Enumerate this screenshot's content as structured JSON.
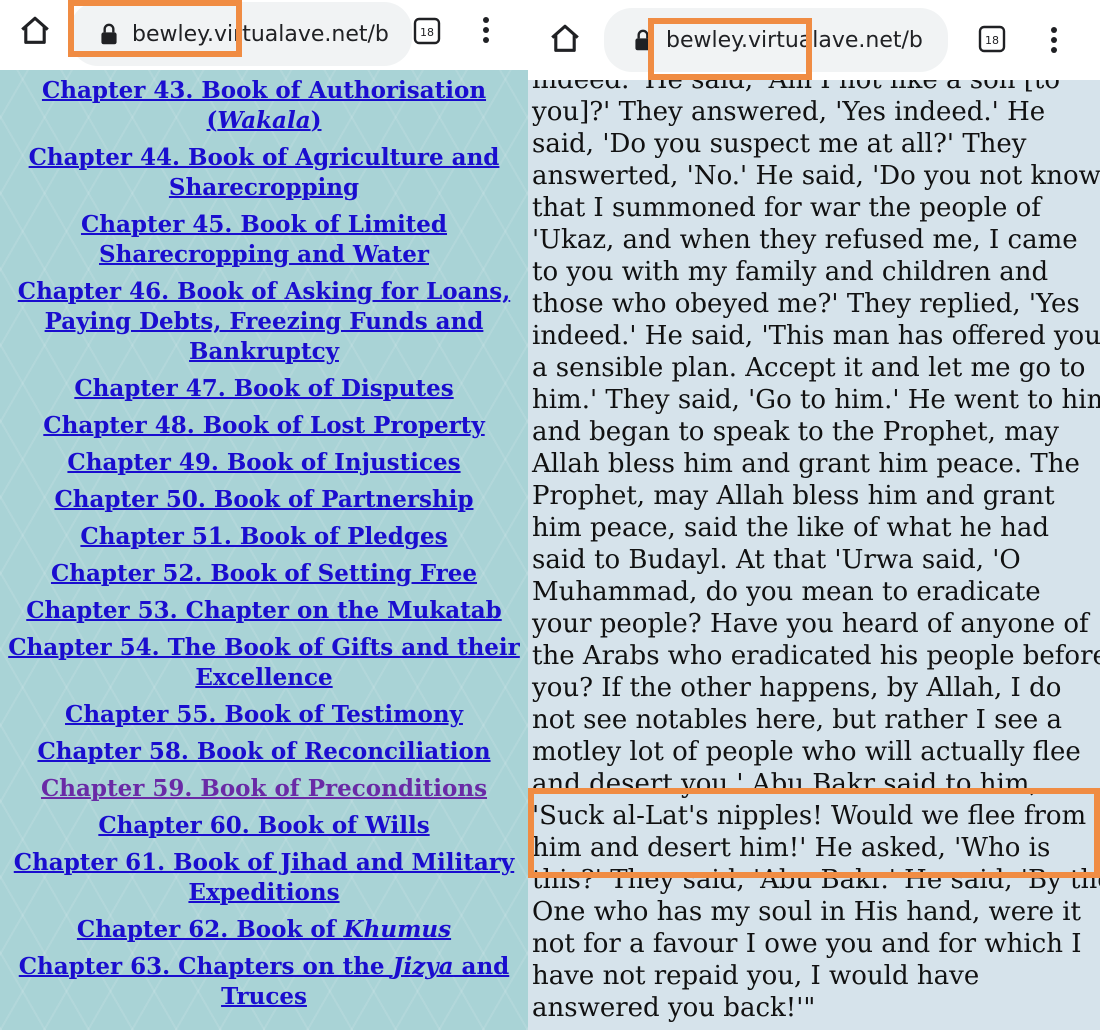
{
  "left_browser": {
    "url": "bewley.virtualave.net/b",
    "tab_count": "18",
    "icons": [
      "home-icon",
      "lock-icon",
      "tab-switcher-icon",
      "overflow-menu-icon"
    ]
  },
  "right_browser": {
    "url": "bewley.virtualave.net/b",
    "tab_count": "18",
    "icons": [
      "home-icon",
      "lock-icon",
      "tab-switcher-icon",
      "overflow-menu-icon"
    ]
  },
  "left_page": {
    "chapters": [
      {
        "pre": "Chapter 43. Book of Authorisation (",
        "em": "Wakala",
        "post": ")"
      },
      {
        "pre": "Chapter 44. Book of Agriculture and Sharecropping"
      },
      {
        "pre": "Chapter 45. Book of Limited Sharecropping and Water"
      },
      {
        "pre": "Chapter 46. Book of Asking for Loans, Paying Debts, Freezing Funds and Bankruptcy"
      },
      {
        "pre": "Chapter 47. Book of Disputes"
      },
      {
        "pre": "Chapter 48. Book of Lost Property"
      },
      {
        "pre": "Chapter 49. Book of Injustices"
      },
      {
        "pre": "Chapter 50. Book of Partnership"
      },
      {
        "pre": "Chapter 51. Book of Pledges"
      },
      {
        "pre": "Chapter 52. Book of Setting Free"
      },
      {
        "pre": "Chapter 53. Chapter on the Mukatab"
      },
      {
        "pre": "Chapter 54. The Book of Gifts and their Excellence"
      },
      {
        "pre": "Chapter 55. Book of Testimony"
      },
      {
        "pre": "Chapter 58. Book of Reconciliation"
      },
      {
        "pre": "Chapter 59. Book of Preconditions",
        "visited": true
      },
      {
        "pre": "Chapter 60. Book of Wills"
      },
      {
        "pre": "Chapter 61. Book of Jihad and Military Expeditions"
      },
      {
        "pre": "Chapter 62. Book of ",
        "em": "Khumus"
      },
      {
        "pre": "Chapter 63. Chapters on the ",
        "em": "Jizya",
        "post": " and Truces"
      }
    ]
  },
  "right_page": {
    "lines": [
      "indeed.' He said, 'Am I not like a son [to",
      "you]?' They answered, 'Yes indeed.' He",
      "said, 'Do you suspect me at all?' They",
      "answerted, 'No.' He said, 'Do you not know",
      "that I summoned for war the people of",
      "'Ukaz, and when they refused me, I came",
      "to you with my family and children and",
      "those who obeyed me?' They replied, 'Yes",
      "indeed.' He said, 'This man has offered you",
      "a sensible plan. Accept it and let me go to",
      "him.' They said, 'Go to him.' He went to him",
      "and began to speak to the Prophet, may",
      "Allah bless him and grant him peace. The",
      "Prophet, may Allah bless him and grant",
      "him peace, said the like of what he had",
      "said to Budayl. At that 'Urwa said, 'O",
      "Muhammad, do you mean to eradicate",
      "your people? Have you heard of anyone of",
      "the Arabs who eradicated his people before",
      "you? If the other happens, by Allah, I do",
      "not see notables here, but rather I see a",
      "motley lot of people who will actually flee",
      "and desert you.' Abu Bakr said to him,",
      "'Suck al-Lat's nipples! Would we flee from",
      "him and desert him!' He asked, 'Who is",
      "this?' They said, 'Abu Bakr.' He said, 'By the",
      "One who has my soul in His hand, were it",
      "not for a favour I owe you and for which I",
      "have not repaid you, I would have",
      "answered you back!'\""
    ]
  }
}
